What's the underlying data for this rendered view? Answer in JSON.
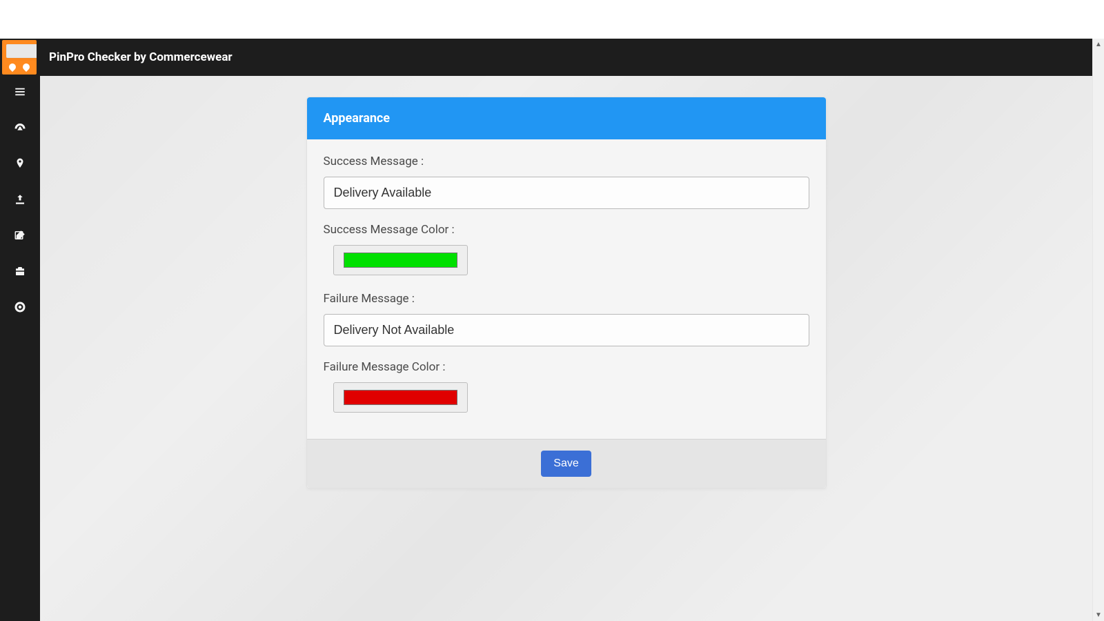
{
  "header": {
    "title": "PinPro Checker by Commercewear"
  },
  "sidebar": {
    "items": [
      {
        "name": "menu-toggle",
        "icon": "bars"
      },
      {
        "name": "dashboard",
        "icon": "gauge"
      },
      {
        "name": "locations",
        "icon": "pin"
      },
      {
        "name": "upload",
        "icon": "upload"
      },
      {
        "name": "edit",
        "icon": "edit"
      },
      {
        "name": "toolbox",
        "icon": "briefcase"
      },
      {
        "name": "support",
        "icon": "lifebuoy"
      }
    ]
  },
  "card": {
    "title": "Appearance",
    "fields": {
      "success_message_label": "Success Message :",
      "success_message_value": "Delivery Available",
      "success_color_label": "Success Message Color :",
      "success_color_value": "#00e000",
      "failure_message_label": "Failure Message :",
      "failure_message_value": "Delivery Not Available",
      "failure_color_label": "Failure Message Color :",
      "failure_color_value": "#e00000"
    },
    "save_label": "Save"
  }
}
